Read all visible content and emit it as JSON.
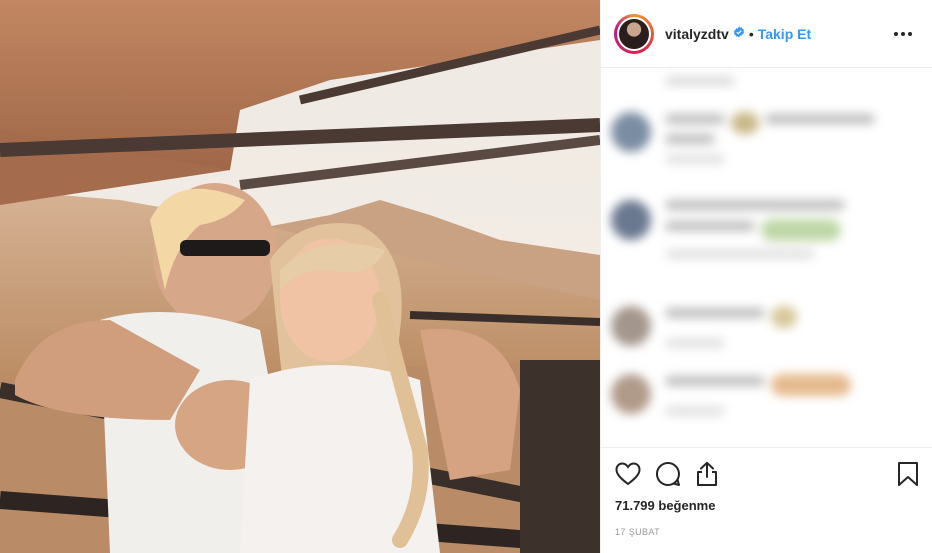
{
  "post": {
    "username": "vitalyzdtv",
    "separator": "•",
    "follow_label": "Takip Et",
    "likes_text": "71.799 beğenme",
    "date_text": "17 ŞUBAT"
  },
  "icons": {
    "verified": "verified-badge-icon",
    "more": "more-options-icon",
    "like": "heart-icon",
    "comment": "comment-icon",
    "share": "share-icon",
    "save": "bookmark-icon"
  },
  "colors": {
    "follow": "#3897f0",
    "verified": "#3897f0",
    "text": "#262626",
    "muted": "#999999"
  }
}
